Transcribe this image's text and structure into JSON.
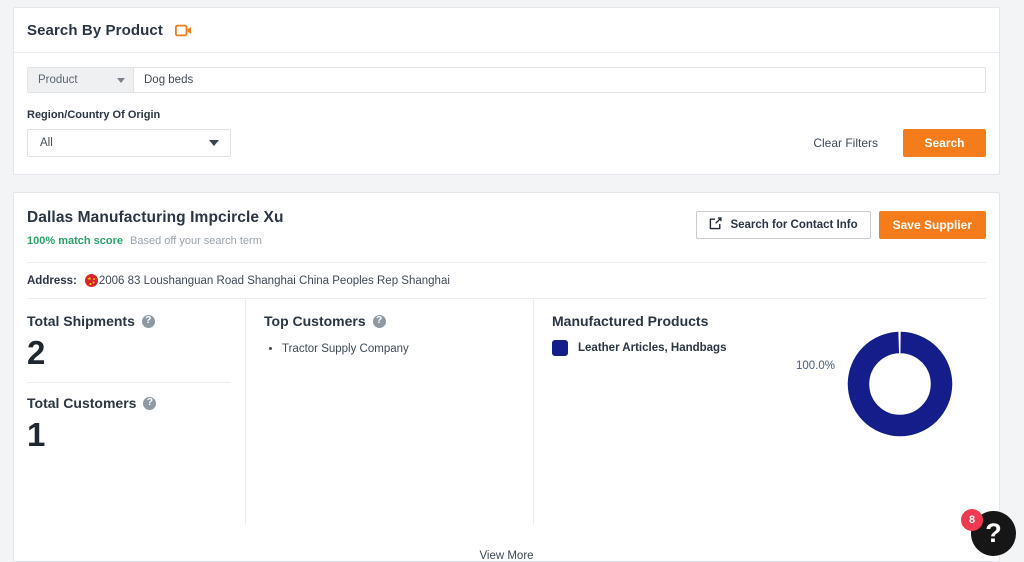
{
  "search_panel": {
    "title": "Search By Product",
    "video_icon": "video-camera-icon",
    "product_select": {
      "value": "Product",
      "caret": "chevron-down-icon"
    },
    "product_input": {
      "value": "Dog beds",
      "placeholder": "Dog beds"
    },
    "region_label": "Region/Country Of Origin",
    "region_select": {
      "value": "All",
      "caret": "chevron-down-icon"
    },
    "clear_filters_label": "Clear Filters",
    "search_button_label": "Search"
  },
  "supplier": {
    "name": "Dallas Manufacturing Impcircle Xu",
    "match_score": "100% match score",
    "match_note": "Based off your search term",
    "contact_button_label": "Search for Contact Info",
    "contact_button_icon": "external-link-icon",
    "save_button_label": "Save Supplier",
    "address_label": "Address:",
    "address_flag": "china-flag-icon",
    "address_value": "2006 83 Loushanguan Road Shanghai China Peoples Rep Shanghai"
  },
  "stats": {
    "shipments_title": "Total Shipments",
    "shipments_value": "2",
    "customers_title": "Total Customers",
    "customers_value": "1",
    "help_glyph": "?"
  },
  "top_customers": {
    "title": "Top Customers",
    "help_glyph": "?",
    "items": [
      "Tractor Supply Company"
    ]
  },
  "manufactured_products": {
    "title": "Manufactured Products",
    "legend": [
      {
        "label": "Leather Articles, Handbags",
        "color": "#151d8a"
      }
    ]
  },
  "chart_data": {
    "type": "pie",
    "variant": "donut",
    "title": "Manufactured Products",
    "categories": [
      "Leather Articles, Handbags"
    ],
    "values": [
      100.0
    ],
    "value_labels": [
      "100.0%"
    ],
    "colors": [
      "#151d8a"
    ],
    "legend_position": "top-left",
    "center_hole_ratio": 0.57,
    "label_text": "100.0%"
  },
  "footer": {
    "view_more_label": "View More"
  },
  "help_widget": {
    "glyph": "?",
    "badge_count": "8"
  },
  "theme": {
    "accent_orange": "#f57c1a",
    "navy": "#151d8a",
    "green": "#29a36a",
    "badge_red": "#ef3b50"
  }
}
